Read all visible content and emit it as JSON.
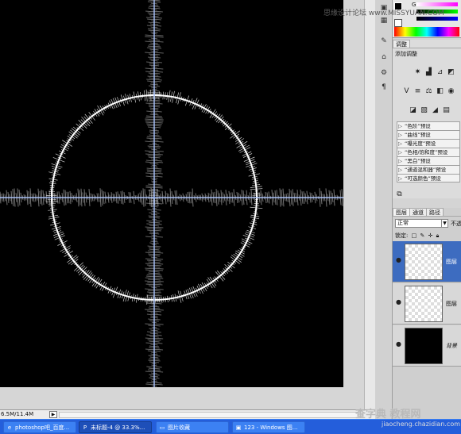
{
  "watermark": {
    "top": "思缘设计论坛 www.MISSYUAN.COM",
    "bottom_big": "查字典 教程网",
    "bottom_small": "jiaocheng.chazidian.com"
  },
  "status_bar": {
    "doc_size": "6.5M/11.4M"
  },
  "swatches": {
    "g_label": "G"
  },
  "adjustments": {
    "tab_label": "调整",
    "title": "添加调整",
    "presets": [
      "“色阶”预设",
      "“曲线”预设",
      "“曝光度”预设",
      "“色相/饱和度”预设",
      "“黑白”预设",
      "“通道混和器”预设",
      "“可选颜色”预设"
    ]
  },
  "layers": {
    "tabs": [
      "图层",
      "通道",
      "路径"
    ],
    "blend_mode": "正常",
    "opacity_label": "不透",
    "lock_label": "锁定:",
    "items": [
      {
        "name": "图层",
        "active": true,
        "thumb": "transparent"
      },
      {
        "name": "图层",
        "active": false,
        "thumb": "transparent"
      },
      {
        "name": "背景",
        "active": false,
        "thumb": "black"
      }
    ]
  },
  "taskbar": {
    "items": [
      {
        "label": "photoshop吧_百度...",
        "icon": "ie-icon"
      },
      {
        "label": "未标题-4 @ 33.3%...",
        "icon": "ps-icon"
      },
      {
        "label": "图片收藏",
        "icon": "folder-icon"
      },
      {
        "label": "123 - Windows 图...",
        "icon": "image-viewer-icon"
      }
    ]
  },
  "colors": {
    "canvas": "#000000",
    "glow": "#ffffff",
    "guide": "#4f7ee8",
    "taskbar": "#245edb",
    "active_layer": "#3d6cc0"
  }
}
